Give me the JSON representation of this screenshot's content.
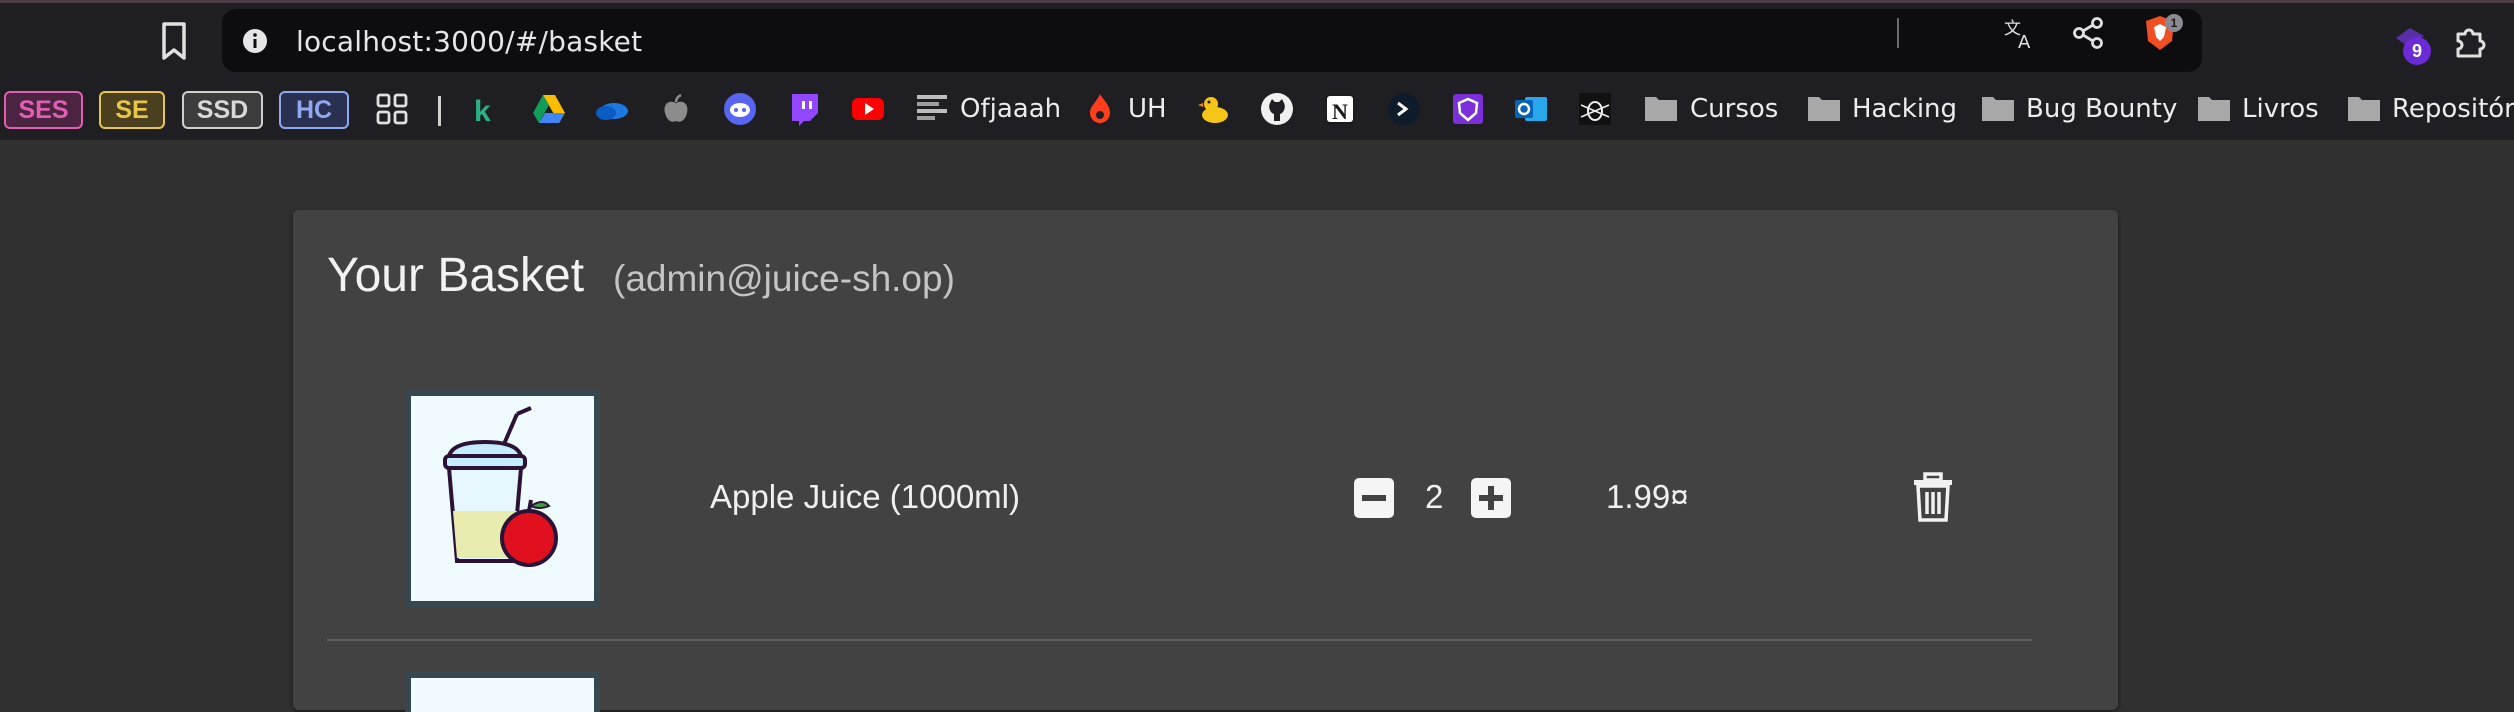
{
  "browser": {
    "url": "localhost:3000/#/basket",
    "brave_shield_count": "1",
    "extension_badge": "9"
  },
  "bookmarks": {
    "chips": [
      {
        "label": "SES",
        "color": "#e05fb3",
        "bg": "#4a2440"
      },
      {
        "label": "SE",
        "color": "#e8c64a",
        "bg": "#4a3f1e"
      },
      {
        "label": "SSD",
        "color": "#cfcfcf",
        "bg": "#3c3c3c"
      },
      {
        "label": "HC",
        "color": "#8fa8f0",
        "bg": "#2a3150"
      }
    ],
    "labels": {
      "ofjaaah": "Ofjaaah",
      "uh": "UH"
    },
    "folders": [
      "Cursos",
      "Hacking",
      "Bug Bounty",
      "Livros",
      "Repositóri"
    ]
  },
  "basket": {
    "title": "Your Basket",
    "user": "(admin@juice-sh.op)",
    "items": [
      {
        "name": "Apple Juice (1000ml)",
        "quantity": "2",
        "price": "1.99¤"
      }
    ]
  }
}
